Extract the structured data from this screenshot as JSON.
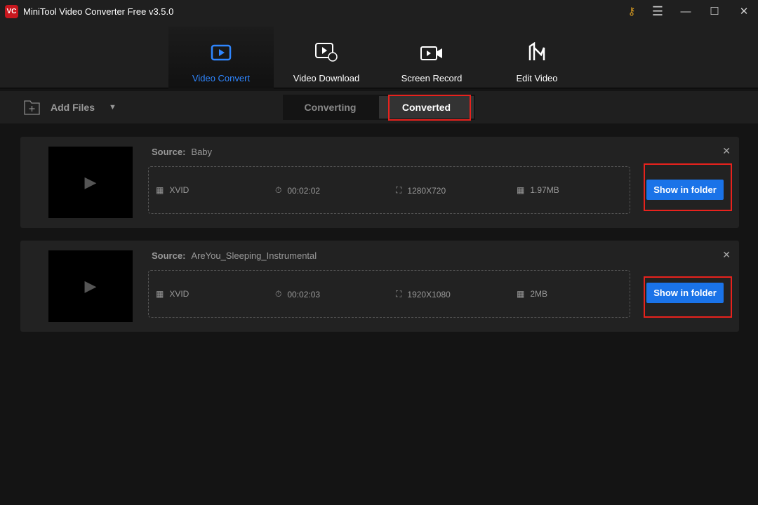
{
  "app": {
    "title": "MiniTool Video Converter Free v3.5.0",
    "logo_text": "VC"
  },
  "nav": [
    {
      "label": "Video Convert",
      "icon": "convert-icon"
    },
    {
      "label": "Video Download",
      "icon": "download-icon"
    },
    {
      "label": "Screen Record",
      "icon": "record-icon"
    },
    {
      "label": "Edit Video",
      "icon": "edit-icon"
    }
  ],
  "toolbar": {
    "add_files": "Add Files"
  },
  "tabs": [
    {
      "label": "Converting"
    },
    {
      "label": "Converted"
    }
  ],
  "files": [
    {
      "source_label": "Source:",
      "source": "Baby",
      "format": "XVID",
      "duration": "00:02:02",
      "resolution": "1280X720",
      "size": "1.97MB",
      "button": "Show in folder"
    },
    {
      "source_label": "Source:",
      "source": "AreYou_Sleeping_Instrumental",
      "format": "XVID",
      "duration": "00:02:03",
      "resolution": "1920X1080",
      "size": "2MB",
      "button": "Show in folder"
    }
  ],
  "colors": {
    "accent": "#2f86ff",
    "button": "#1a73e8",
    "highlight": "#e8221d"
  }
}
